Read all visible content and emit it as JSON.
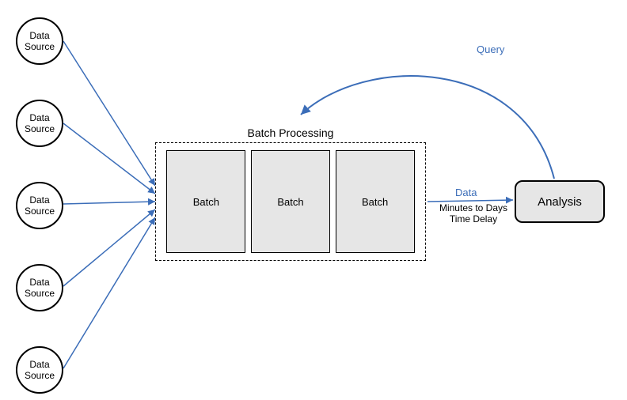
{
  "diagram": {
    "title": "Batch Processing",
    "dataSourceLabel": "Data\nSource",
    "sources": [
      {
        "label": "Data Source"
      },
      {
        "label": "Data Source"
      },
      {
        "label": "Data Source"
      },
      {
        "label": "Data Source"
      },
      {
        "label": "Data Source"
      }
    ],
    "batches": [
      {
        "label": "Batch"
      },
      {
        "label": "Batch"
      },
      {
        "label": "Batch"
      }
    ],
    "analysisLabel": "Analysis",
    "edgeLabels": {
      "data": "Data",
      "delay": "Minutes to Days\nTime Delay",
      "query": "Query"
    }
  }
}
